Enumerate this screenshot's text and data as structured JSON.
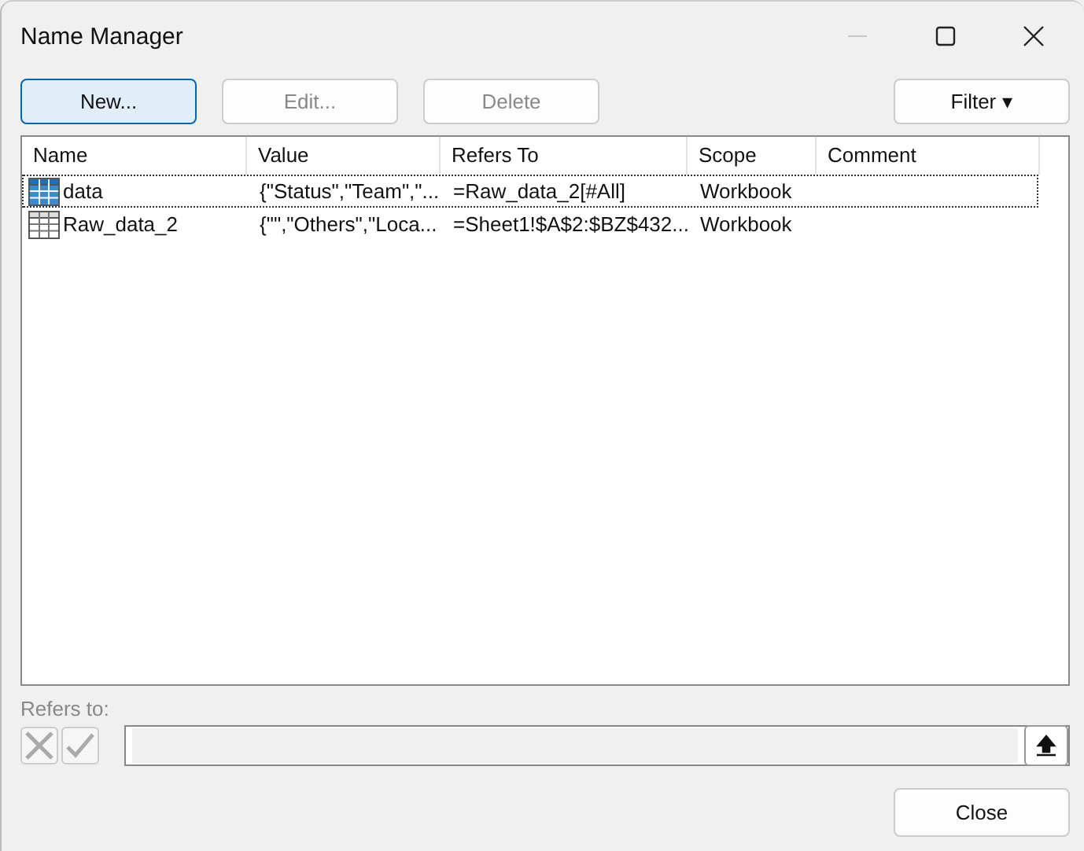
{
  "window": {
    "title": "Name Manager"
  },
  "buttons": [
    {
      "label": "New...",
      "kind": "default",
      "disabled": false
    },
    {
      "label": "Edit...",
      "kind": "plain",
      "disabled": true
    },
    {
      "label": "Delete",
      "kind": "plain",
      "disabled": true
    }
  ],
  "filter_button": {
    "label": "Filter",
    "icon": "▾"
  },
  "table": {
    "columns": [
      "Name",
      "Value",
      "Refers To",
      "Scope",
      "Comment"
    ],
    "rows": [
      {
        "selected": true,
        "cells": [
          "data",
          "{\"Status\",\"Team\",\"...",
          "=Raw_data_2[#All]",
          "Workbook"
        ]
      },
      {
        "selected": false,
        "cells": [
          "Raw_data_2",
          "{\"\",\"Others\",\"Loca...",
          "=Sheet1!$A$2:$BZ$432...",
          "Workbook"
        ]
      }
    ]
  },
  "refers_to": {
    "label": "Refers to:",
    "disabled": true
  },
  "close_button": {
    "label": "Close"
  }
}
